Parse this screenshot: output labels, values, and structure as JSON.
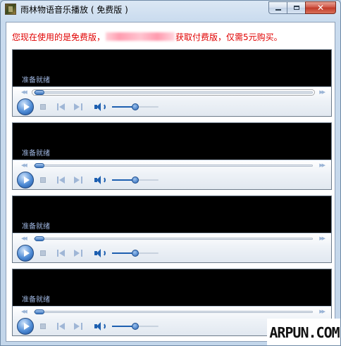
{
  "window": {
    "title": "雨林物语音乐播放 ( 免费版 )",
    "close_glyph": "✕"
  },
  "notice": {
    "prefix": "您现在使用的是免费版，",
    "suffix": "获取付费版，仅需5元购买。"
  },
  "players": [
    {
      "status": "准备就绪",
      "seek_progress": 0.0,
      "volume": 0.5
    },
    {
      "status": "准备就绪",
      "seek_progress": 0.0,
      "volume": 0.5
    },
    {
      "status": "准备就绪",
      "seek_progress": 0.0,
      "volume": 0.5
    },
    {
      "status": "准备就绪",
      "seek_progress": 0.0,
      "volume": 0.5
    }
  ],
  "seek_arrows": {
    "left": "◀◀",
    "right": "▶▶"
  },
  "watermark": {
    "text": "ARPUN.COM"
  },
  "colors": {
    "notice": "#e00000",
    "status": "#9fb6e0",
    "accent": "#1d5fb0"
  },
  "icons": [
    "app-icon",
    "play-icon",
    "stop-icon",
    "previous-icon",
    "next-icon",
    "speaker-icon"
  ]
}
